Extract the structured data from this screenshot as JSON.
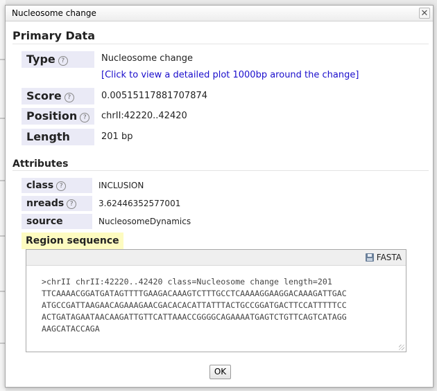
{
  "dialog": {
    "title": "Nucleosome change",
    "close_glyph": "✕"
  },
  "primary": {
    "heading": "Primary Data",
    "rows": {
      "type": {
        "label": "Type",
        "value": "Nucleosome change"
      },
      "plot_link": "[Click to view a detailed plot 1000bp around the change]",
      "score": {
        "label": "Score",
        "value": "0.00515117881707874"
      },
      "position": {
        "label": "Position",
        "value": "chrII:42220..42420"
      },
      "length": {
        "label": "Length",
        "value": "201 bp"
      }
    },
    "help_glyph": "?"
  },
  "attributes": {
    "heading": "Attributes",
    "class": {
      "label": "class",
      "value": "INCLUSION"
    },
    "nreads": {
      "label": "nreads",
      "value": "3.62446352577001"
    },
    "source": {
      "label": "source",
      "value": "NucleosomeDynamics"
    }
  },
  "region_sequence": {
    "label": "Region sequence",
    "fasta_button": "FASTA",
    "fasta_icon": "floppy-disk-icon",
    "sequence_text": ">chrII chrII:42220..42420 class=Nucleosome change length=201\nTTCAAAACGGATGATAGTTTTGAAGACAAAGTCTTTGCCTCAAAAGGAAGGACAAAGATTGAC\nATGCCGATTAAGAACAGAAAGAACGACACACATTATTTACTGCCGGATGACTTCCATTTTTCC\nACTGATAGAATAACAAGATTGTTCATTAAACCGGGGCAGAAAATGAGTCTGTTCAGTCATAGG\nAAGCATACCAGA"
  },
  "ok_button": "OK",
  "colors": {
    "label_bg": "#eaeaf6",
    "highlight_bg": "#fdfbc0",
    "link": "#1a0dcc"
  }
}
